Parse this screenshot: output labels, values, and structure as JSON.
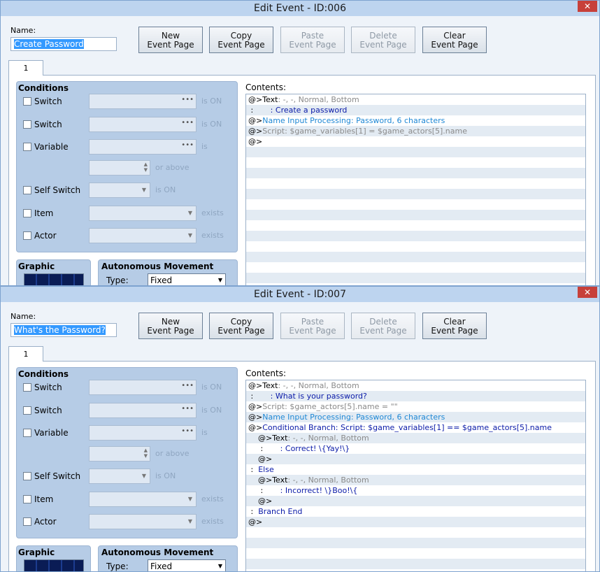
{
  "windows": [
    {
      "title": "Edit Event - ID:006",
      "close_glyph": "✕",
      "name_label": "Name:",
      "name_value": "Create Password",
      "buttons": {
        "new": [
          "New",
          "Event Page"
        ],
        "copy": [
          "Copy",
          "Event Page"
        ],
        "paste": [
          "Paste",
          "Event Page"
        ],
        "delete": [
          "Delete",
          "Event Page"
        ],
        "clear": [
          "Clear",
          "Event Page"
        ]
      },
      "tab_label": "1",
      "conditions": {
        "title": "Conditions",
        "switch1": "Switch",
        "switch2": "Switch",
        "variable": "Variable",
        "self_switch": "Self Switch",
        "item": "Item",
        "actor": "Actor",
        "is_on": "is ON",
        "is": "is",
        "or_above": "or above",
        "exists": "exists"
      },
      "graphic_title": "Graphic",
      "autonomous_title": "Autonomous Movement",
      "type_label": "Type:",
      "type_value": "Fixed",
      "contents_label": "Contents:",
      "contents": [
        [
          {
            "t": "@>",
            "c": "black"
          },
          {
            "t": "Text",
            "c": "black"
          },
          {
            "t": ": -, -, Normal, Bottom",
            "c": "gray"
          }
        ],
        [
          {
            "t": " :",
            "c": "black"
          },
          {
            "t": "       : Create a password",
            "c": "blue"
          }
        ],
        [
          {
            "t": "@>",
            "c": "black"
          },
          {
            "t": "Name Input Processing: Password, 6 characters",
            "c": "teal"
          }
        ],
        [
          {
            "t": "@>",
            "c": "black"
          },
          {
            "t": "Script: $game_variables[1] = $game_actors[5].name",
            "c": "gray"
          }
        ],
        [
          {
            "t": "@>",
            "c": "black"
          }
        ]
      ]
    },
    {
      "title": "Edit Event - ID:007",
      "close_glyph": "✕",
      "name_label": "Name:",
      "name_value": "What's the Password?",
      "buttons": {
        "new": [
          "New",
          "Event Page"
        ],
        "copy": [
          "Copy",
          "Event Page"
        ],
        "paste": [
          "Paste",
          "Event Page"
        ],
        "delete": [
          "Delete",
          "Event Page"
        ],
        "clear": [
          "Clear",
          "Event Page"
        ]
      },
      "tab_label": "1",
      "conditions": {
        "title": "Conditions",
        "switch1": "Switch",
        "switch2": "Switch",
        "variable": "Variable",
        "self_switch": "Self Switch",
        "item": "Item",
        "actor": "Actor",
        "is_on": "is ON",
        "is": "is",
        "or_above": "or above",
        "exists": "exists"
      },
      "graphic_title": "Graphic",
      "autonomous_title": "Autonomous Movement",
      "type_label": "Type:",
      "type_value": "Fixed",
      "contents_label": "Contents:",
      "contents": [
        [
          {
            "t": "@>",
            "c": "black"
          },
          {
            "t": "Text",
            "c": "black"
          },
          {
            "t": ": -, -, Normal, Bottom",
            "c": "gray"
          }
        ],
        [
          {
            "t": " :",
            "c": "black"
          },
          {
            "t": "       : What is your password?",
            "c": "blue"
          }
        ],
        [
          {
            "t": "@>",
            "c": "black"
          },
          {
            "t": "Script: $game_actors[5].name = \"\"",
            "c": "gray"
          }
        ],
        [
          {
            "t": "@>",
            "c": "black"
          },
          {
            "t": "Name Input Processing: Password, 6 characters",
            "c": "teal"
          }
        ],
        [
          {
            "t": "@>",
            "c": "black"
          },
          {
            "t": "Conditional Branch: Script: $game_variables[1] == $game_actors[5].name",
            "c": "blue"
          }
        ],
        [
          {
            "t": "    @>",
            "c": "black"
          },
          {
            "t": "Text",
            "c": "black"
          },
          {
            "t": ": -, -, Normal, Bottom",
            "c": "gray"
          }
        ],
        [
          {
            "t": "     :",
            "c": "black"
          },
          {
            "t": "       : Correct! \\{Yay!\\}",
            "c": "blue"
          }
        ],
        [
          {
            "t": "    @>",
            "c": "black"
          }
        ],
        [
          {
            "t": " :  ",
            "c": "black"
          },
          {
            "t": "Else",
            "c": "blue"
          }
        ],
        [
          {
            "t": "    @>",
            "c": "black"
          },
          {
            "t": "Text",
            "c": "black"
          },
          {
            "t": ": -, -, Normal, Bottom",
            "c": "gray"
          }
        ],
        [
          {
            "t": "     :",
            "c": "black"
          },
          {
            "t": "       : Incorrect! \\}Boo!\\{",
            "c": "blue"
          }
        ],
        [
          {
            "t": "    @>",
            "c": "black"
          }
        ],
        [
          {
            "t": " :  ",
            "c": "black"
          },
          {
            "t": "Branch End",
            "c": "blue"
          }
        ],
        [
          {
            "t": "@>",
            "c": "black"
          }
        ]
      ]
    }
  ],
  "colors": {
    "window_bg": "#eef3f9",
    "panel_bg": "#b6cce6",
    "selection": "#3399ff",
    "close_button": "#c7403a",
    "command_blue": "#0a1aa8",
    "command_teal": "#1f88d5",
    "command_gray": "#8a8a8a"
  },
  "icons": [
    "close-icon",
    "ellipsis-icon",
    "dropdown-arrow-icon",
    "spin-arrows-icon"
  ]
}
